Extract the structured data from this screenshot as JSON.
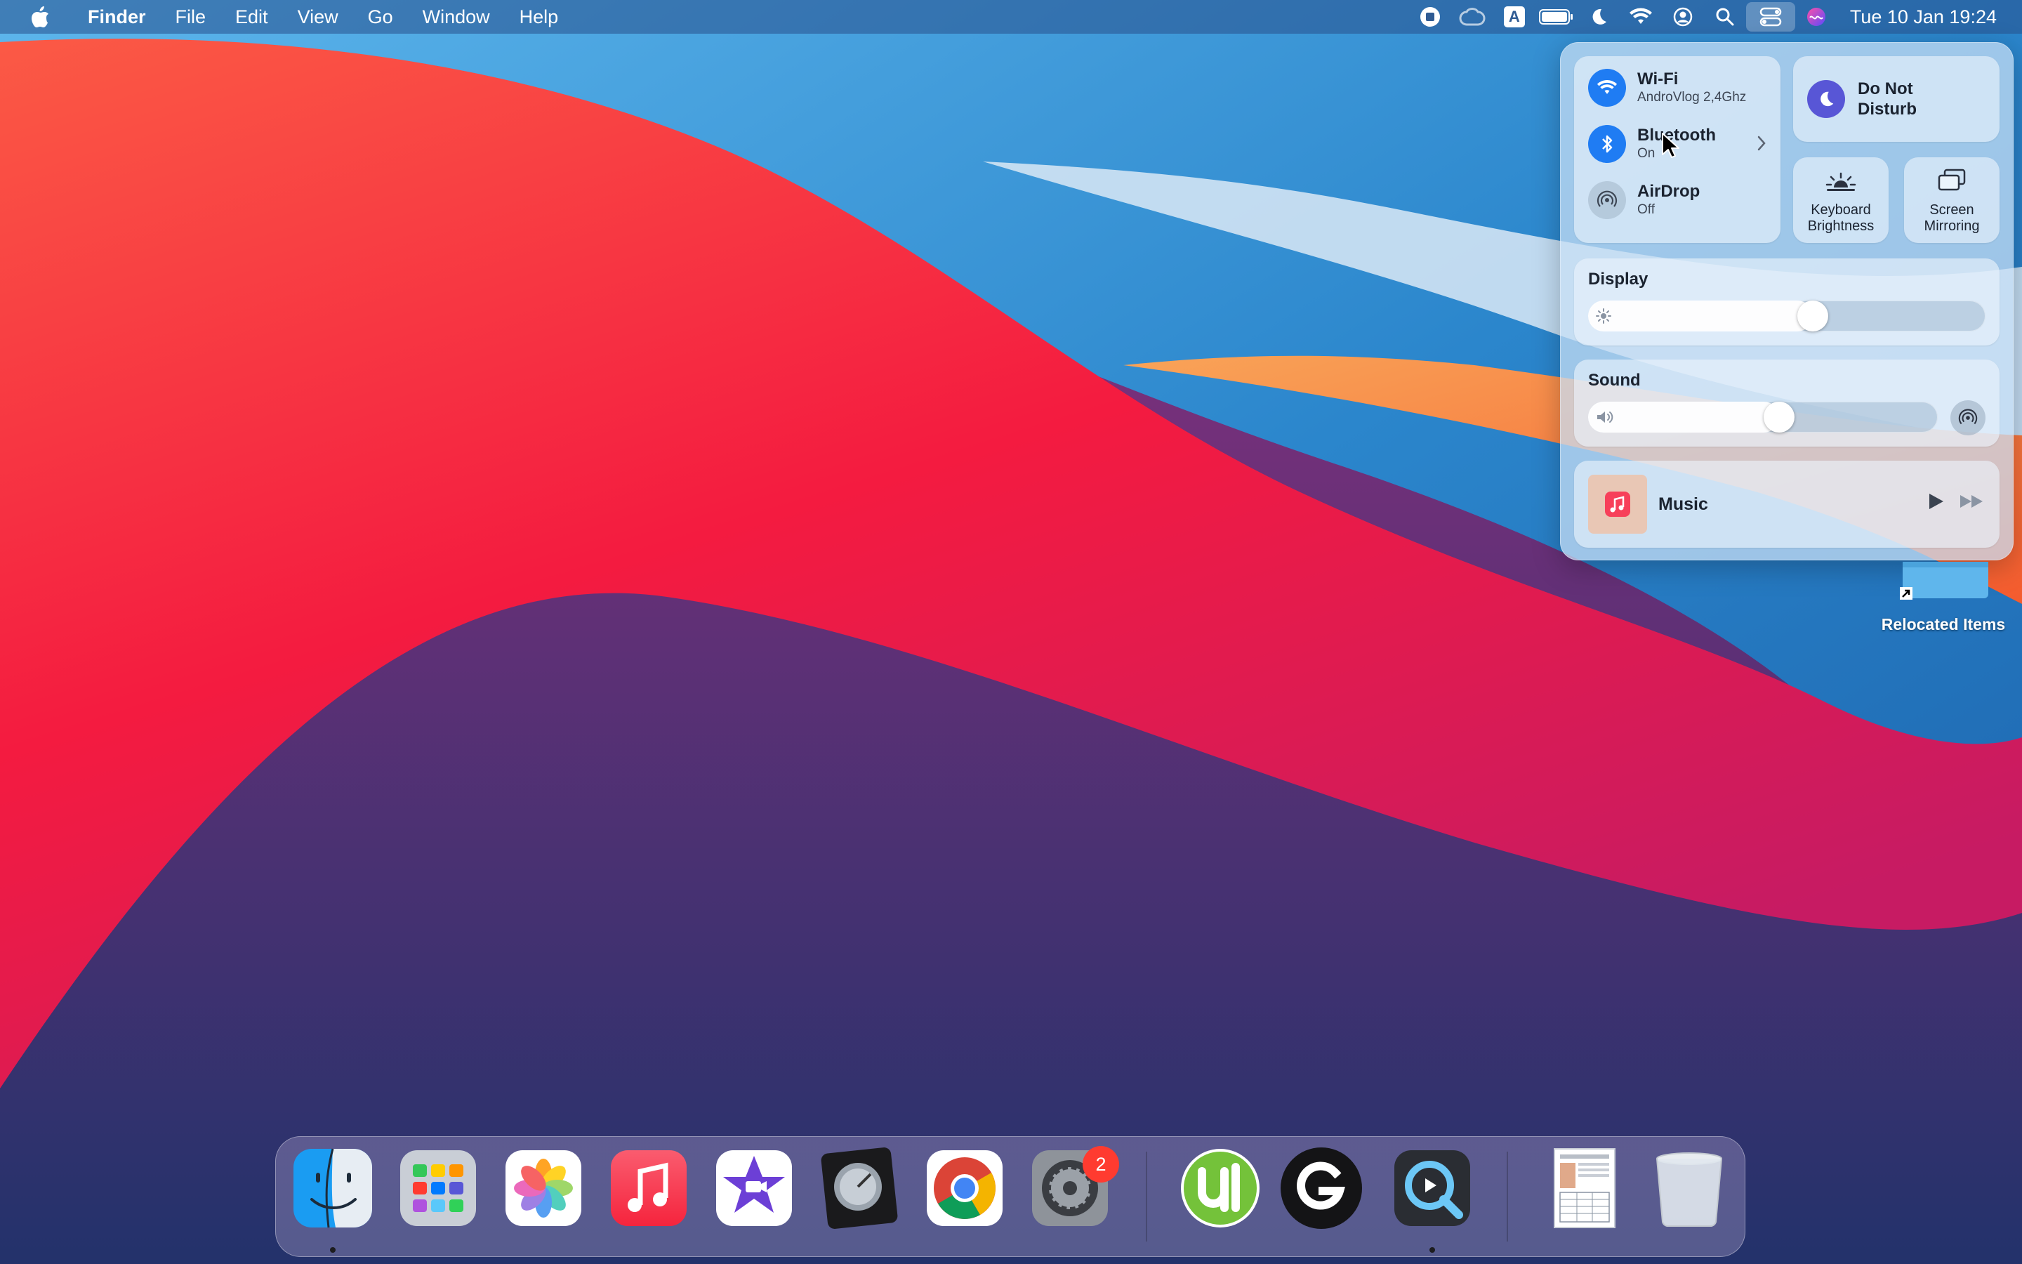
{
  "menubar": {
    "app_name": "Finder",
    "menus": [
      "File",
      "Edit",
      "View",
      "Go",
      "Window",
      "Help"
    ],
    "input_source": "A",
    "clock": "Tue 10 Jan  19:24"
  },
  "control_center": {
    "wifi": {
      "title": "Wi-Fi",
      "subtitle": "AndroVlog 2,4Ghz"
    },
    "bluetooth": {
      "title": "Bluetooth",
      "subtitle": "On"
    },
    "airdrop": {
      "title": "AirDrop",
      "subtitle": "Off"
    },
    "dnd": {
      "line1": "Do Not",
      "line2": "Disturb"
    },
    "keyboard": {
      "line1": "Keyboard",
      "line2": "Brightness"
    },
    "mirroring": {
      "line1": "Screen",
      "line2": "Mirroring"
    },
    "display": {
      "label": "Display",
      "level": 0.57
    },
    "sound": {
      "label": "Sound",
      "level": 0.55
    },
    "music": {
      "title": "Music"
    }
  },
  "desktop": {
    "folder_label": "Relocated Items"
  },
  "dock": {
    "apps": [
      "Finder",
      "Launchpad",
      "Photos",
      "Music",
      "iMovie",
      "Logic Pro",
      "Google Chrome",
      "System Preferences",
      "uTorrent",
      "Logitech G HUB",
      "QuickTime Player",
      "Document",
      "Trash"
    ],
    "preferences_badge": "2"
  },
  "colors": {
    "accent": "#1f7cf3",
    "dnd": "#5856d6",
    "badge": "#ff3b30"
  }
}
